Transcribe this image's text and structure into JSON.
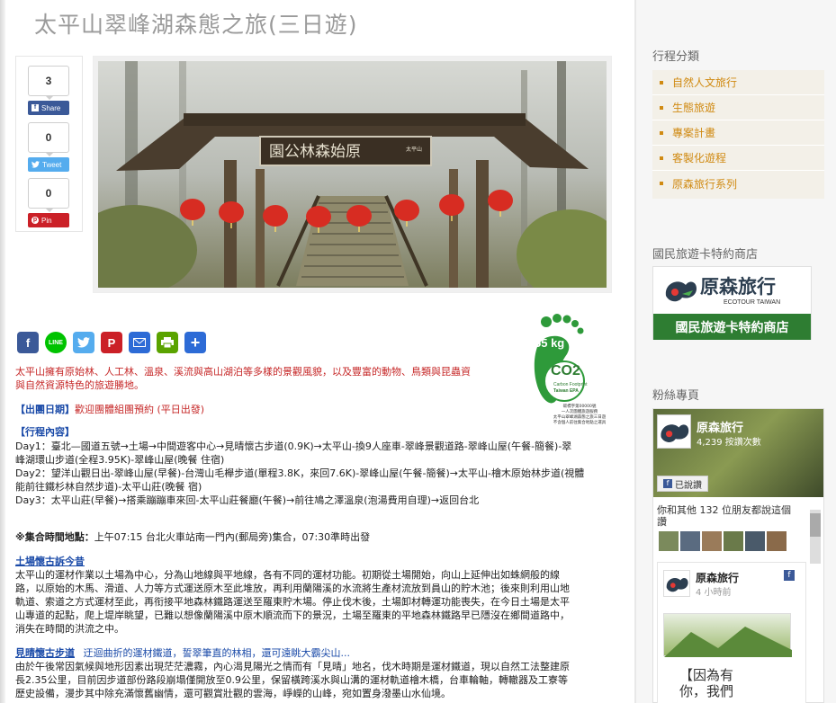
{
  "page": {
    "title": "太平山翠峰湖森態之旅(三日遊)"
  },
  "share": {
    "facebook": {
      "count": "3",
      "label": "Share"
    },
    "twitter": {
      "count": "0",
      "label": "Tweet"
    },
    "pinterest": {
      "count": "0",
      "label": "Pin"
    }
  },
  "hero": {
    "sign_text": "園公林森始原",
    "sign_small": "太平山"
  },
  "social_icons": [
    "facebook",
    "line",
    "twitter",
    "pinterest",
    "email",
    "print",
    "more"
  ],
  "co2": {
    "weight": "55 kg",
    "label": "CO2",
    "sub1": "Carbon Footprint",
    "sub2": "Taiwan EPA",
    "note1": "碳標字第00000號",
    "note2": "一人次團體旅遊服務",
    "note3": "太平山翠峰湖森態之旅三日遊",
    "note4": "不含個人前往集合地點之運具"
  },
  "content": {
    "intro": "太平山擁有原始林、人工林、溫泉、溪流與高山湖泊等多樣的景觀風貌，以及豐富的動物、鳥類與昆蟲資",
    "intro2": "與自然資源特色的旅遊勝地。",
    "departure_label": "【出團日期】",
    "departure_text": "歡迎團體組團預約 (平日出發)",
    "itinerary_label": "【行程內容】",
    "day1": "Day1：臺北—國道五號→土場→中間遊客中心→見晴懷古步道(0.9K)→太平山-換9人座車-翠峰景觀道路-翠峰山屋(午餐-簡餐)-翠",
    "day1b": "峰湖環山步道(全程3.95K)-翠峰山屋(晚餐 住宿)",
    "day2": "Day2：望洋山觀日出-翠峰山屋(早餐)-台灣山毛櫸步道(單程3.8K，來回7.6K)-翠峰山屋(午餐-簡餐)→太平山-檜木原始林步道(視體",
    "day2b": "能前往鐵杉林自然步道)-太平山莊(晚餐 宿)",
    "day3": "Day3：太平山莊(早餐)→搭乘蹦蹦車來回-太平山莊餐廳(午餐)→前往鳩之澤溫泉(泡湯費用自理)→返回台北",
    "meeting_label": "※集合時間地點：",
    "meeting_text": "上午07:15 台北火車站南一門內(郵局旁)集合，07:30準時出發",
    "section1_title": "土場懷古訴今昔",
    "section1_p1": "太平山的運材作業以土場為中心，分為山地線與平地線，各有不同的運材功能。初期從土場開始，向山上延伸出如蛛網般的線",
    "section1_p2": "路，以原始的木馬、滑道、人力等方式運送原木至此堆放，再利用蘭陽溪的水流將生產材流放到員山的貯木池；後來則利用山地",
    "section1_p3": "軌道、索道之方式運材至此，再衔接平地森林鐵路運送至羅東貯木場。停止伐木後，土場卸材轉運功能喪失，在今日土場是太平",
    "section1_p4": "山專道的起點，爬上堤岸眺望，已難以想像蘭陽溪中原木順流而下的景況，土場至羅東的平地森林鐵路早已隱沒在鄉間道路中，",
    "section1_p5": "消失在時間的洪流之中。",
    "section2_title": "見晴懷古步道",
    "section2_lead": "迂迴曲折的運材鐵道，誓翠筆直的林相，還可遠眺大霸尖山...",
    "section2_p1": "由於午後常因氣候與地形因素出現茫茫濃霧，內心渴見陽光之情而有「見晴」地名，伐木時期是運材鐵道，現以自然工法整建原",
    "section2_p2": "長2.35公里，目前因步道部份路段崩塌僅開放至0.9公里，保留橫跨溪水與山溝的運材軌道檜木橋，台車輪軸，轉轍器及工寮等",
    "section2_p3": "歷史設備，漫步其中除充滿懷舊幽情，還可觀賞壯觀的雲海，崢嶸的山峰，宛如置身潑墨山水仙境。"
  },
  "sidebar": {
    "categories_title": "行程分類",
    "categories": [
      "自然人文旅行",
      "生態旅遊",
      "專案計畫",
      "客製化遊程",
      "原森旅行系列"
    ],
    "card_title": "國民旅遊卡特約商店",
    "card_brand": "原森旅行",
    "card_brand_en": "ECOTOUR TAIWAN",
    "card_caption": "國民旅遊卡特約商店",
    "fans_title": "粉絲專頁",
    "fb_page_name": "原森旅行",
    "fb_likes": "4,239 按讚次數",
    "fb_liked": "已說讚",
    "fb_friends": "你和其他 132 位朋友都說這個讚",
    "fb_post_name": "原森旅行",
    "fb_post_time": "4 小時前",
    "fb_post_text1": "【因為有",
    "fb_post_text2": "你，我們"
  },
  "colors": {
    "accent_orange": "#d08a12",
    "title_gray": "#9a9a9a",
    "link_blue": "#1a4aa8",
    "red": "#c62828",
    "facebook": "#3b5998",
    "twitter": "#55acee",
    "pinterest": "#cb2027",
    "line": "#00c300",
    "email": "#2d6bd6",
    "print": "#5aa300"
  }
}
